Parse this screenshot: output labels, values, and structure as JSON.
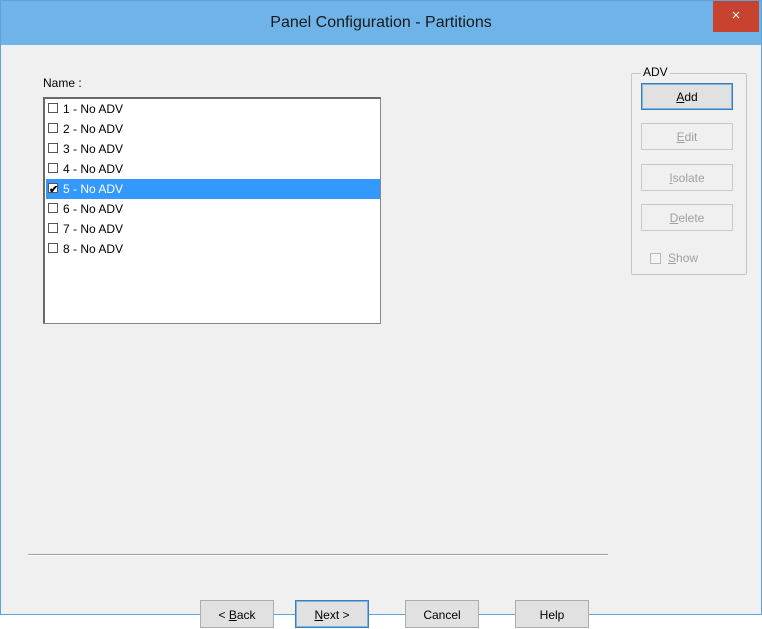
{
  "window": {
    "title": "Panel Configuration - Partitions",
    "close_glyph": "×"
  },
  "name_label": "Name :",
  "partitions": [
    {
      "label": "1 - No ADV",
      "checked": false,
      "selected": false
    },
    {
      "label": "2 - No ADV",
      "checked": false,
      "selected": false
    },
    {
      "label": "3 - No ADV",
      "checked": false,
      "selected": false
    },
    {
      "label": "4 - No ADV",
      "checked": false,
      "selected": false
    },
    {
      "label": "5 - No ADV",
      "checked": true,
      "selected": true
    },
    {
      "label": "6 - No ADV",
      "checked": false,
      "selected": false
    },
    {
      "label": "7 - No ADV",
      "checked": false,
      "selected": false
    },
    {
      "label": "8 - No ADV",
      "checked": false,
      "selected": false
    }
  ],
  "adv_group": {
    "legend": "ADV",
    "add": {
      "mnemonic": "A",
      "rest": "dd"
    },
    "edit": {
      "mnemonic": "E",
      "rest": "dit"
    },
    "isolate": {
      "mnemonic": "I",
      "rest": "solate"
    },
    "delete": {
      "mnemonic": "D",
      "rest": "elete"
    },
    "show": {
      "mnemonic": "S",
      "rest": "how",
      "checked": false
    }
  },
  "footer": {
    "back": {
      "prefix": "< ",
      "mnemonic": "B",
      "rest": "ack"
    },
    "next": {
      "mnemonic": "N",
      "rest": "ext >"
    },
    "cancel": "Cancel",
    "help": "Help"
  },
  "colors": {
    "titlebar": "#6fb4e8",
    "close": "#c7432f",
    "selection": "#3399ff"
  }
}
